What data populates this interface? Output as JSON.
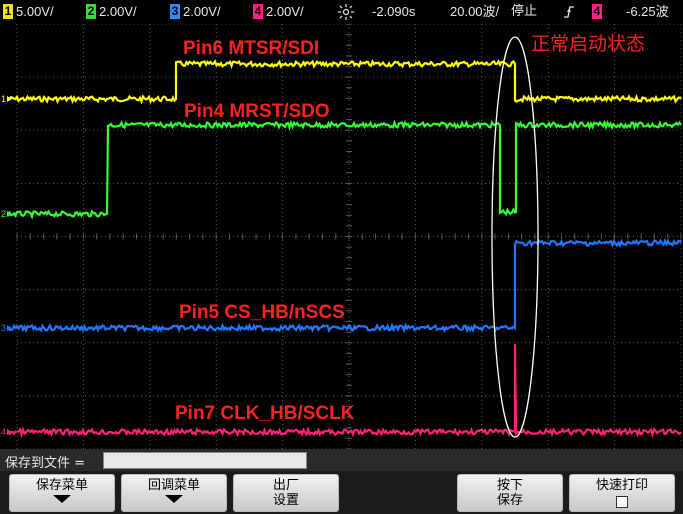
{
  "topbar": {
    "ch1": {
      "num": "1",
      "value": "5.00V/",
      "color": "#e8e800"
    },
    "ch2": {
      "num": "2",
      "value": "2.00V/",
      "color": "#33dd33"
    },
    "ch3": {
      "num": "3",
      "value": "2.00V/",
      "color": "#3388ff"
    },
    "ch4": {
      "num": "4",
      "value": "2.00V/",
      "color": "#ff2288"
    },
    "trigger_icon": "trigger-position-icon",
    "time_offset": "-2.090s",
    "timebase": "20.00波/",
    "run_state": "停止",
    "trigger_slope_icon": "rising-edge-icon",
    "trigger_source": "4",
    "trigger_level": "-6.25波"
  },
  "screen": {
    "status_text": "正常启动状态",
    "channel_labels": [
      {
        "text": "Pin6 MTSR/SDI"
      },
      {
        "text": "Pin4 MRST/SDO"
      },
      {
        "text": "Pin5 CS_HB/nSCS"
      },
      {
        "text": "Pin7 CLK_HB/SCLK"
      }
    ],
    "ground_markers": [
      "1",
      "2",
      "3",
      "4"
    ],
    "colors": {
      "ch1": "#ffff00",
      "ch2": "#33ff33",
      "ch3": "#2277ff",
      "ch4": "#ff2277",
      "grid": "#5a5a5a"
    }
  },
  "bottom": {
    "save_to_file_label": "保存到文件 =",
    "save_to_file_value": "",
    "softkeys": [
      {
        "line1": "保存菜单",
        "line2": ""
      },
      {
        "line1": "回调菜单",
        "line2": ""
      },
      {
        "line1": "出厂",
        "line2": "设置"
      },
      {
        "line1": "按下",
        "line2": "保存"
      },
      {
        "line1": "快速打印",
        "line2": ""
      }
    ]
  }
}
